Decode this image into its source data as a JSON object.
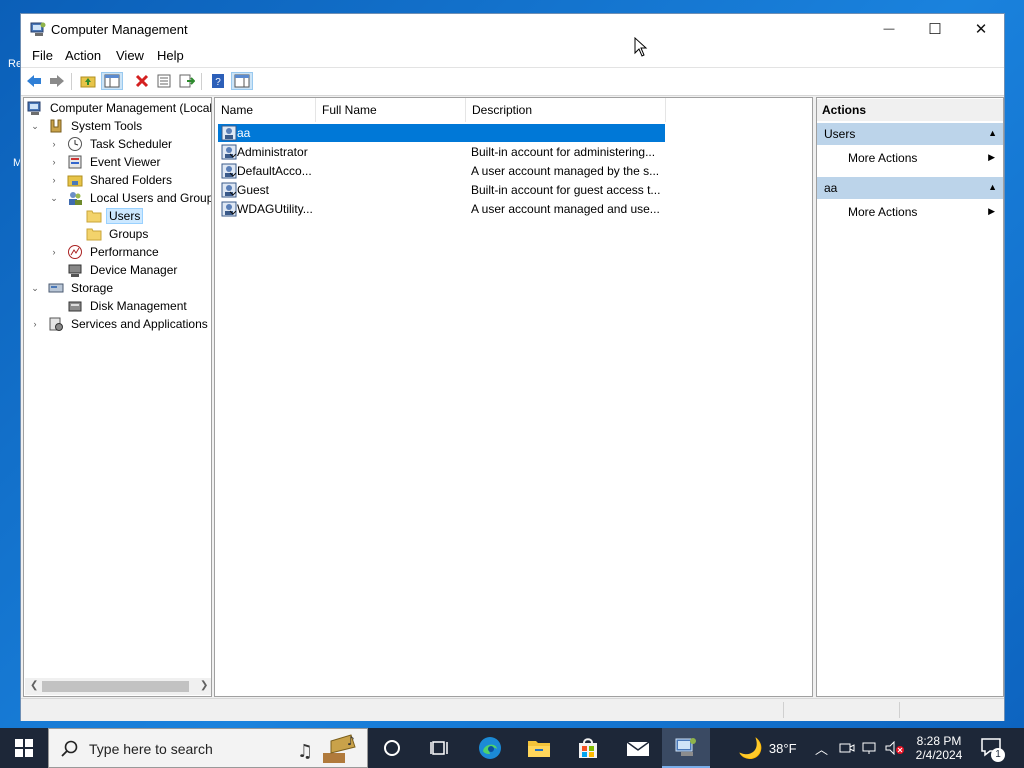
{
  "window": {
    "title": "Computer Management",
    "controls": {
      "minimize": "—",
      "maximize": "☐",
      "close": "✕"
    }
  },
  "menubar": [
    "File",
    "Action",
    "View",
    "Help"
  ],
  "tree": {
    "items": [
      {
        "label": "Computer Management (Local",
        "icon": "computer-management-icon"
      },
      {
        "label": "System Tools",
        "icon": "system-tools-icon"
      },
      {
        "label": "Task Scheduler",
        "icon": "clock-icon"
      },
      {
        "label": "Event Viewer",
        "icon": "event-viewer-icon"
      },
      {
        "label": "Shared Folders",
        "icon": "shared-folder-icon"
      },
      {
        "label": "Local Users and Groups",
        "icon": "users-group-icon"
      },
      {
        "label": "Users",
        "icon": "folder-icon"
      },
      {
        "label": "Groups",
        "icon": "folder-icon"
      },
      {
        "label": "Performance",
        "icon": "performance-icon"
      },
      {
        "label": "Device Manager",
        "icon": "device-manager-icon"
      },
      {
        "label": "Storage",
        "icon": "storage-icon"
      },
      {
        "label": "Disk Management",
        "icon": "disk-icon"
      },
      {
        "label": "Services and Applications",
        "icon": "services-icon"
      }
    ]
  },
  "list": {
    "columns": [
      "Name",
      "Full Name",
      "Description"
    ],
    "rows": [
      {
        "name": "aa",
        "full_name": "",
        "description": ""
      },
      {
        "name": "Administrator",
        "full_name": "",
        "description": "Built-in account for administering..."
      },
      {
        "name": "DefaultAcco...",
        "full_name": "",
        "description": "A user account managed by the s..."
      },
      {
        "name": "Guest",
        "full_name": "",
        "description": "Built-in account for guest access t..."
      },
      {
        "name": "WDAGUtility...",
        "full_name": "",
        "description": "A user account managed and use..."
      }
    ]
  },
  "actions": {
    "header": "Actions",
    "sections": [
      {
        "title": "Users",
        "item": "More Actions"
      },
      {
        "title": "aa",
        "item": "More Actions"
      }
    ]
  },
  "taskbar": {
    "search_placeholder": "Type here to search",
    "weather": "38°F",
    "time": "8:28 PM",
    "date": "2/4/2024",
    "notification_count": "1"
  },
  "desktop": {
    "icon_label_1": "Re",
    "icon_label_2": "M"
  },
  "colors": {
    "selection": "#0078d7",
    "actions_section": "#bcd4ea",
    "taskbar": "#1d2738"
  }
}
